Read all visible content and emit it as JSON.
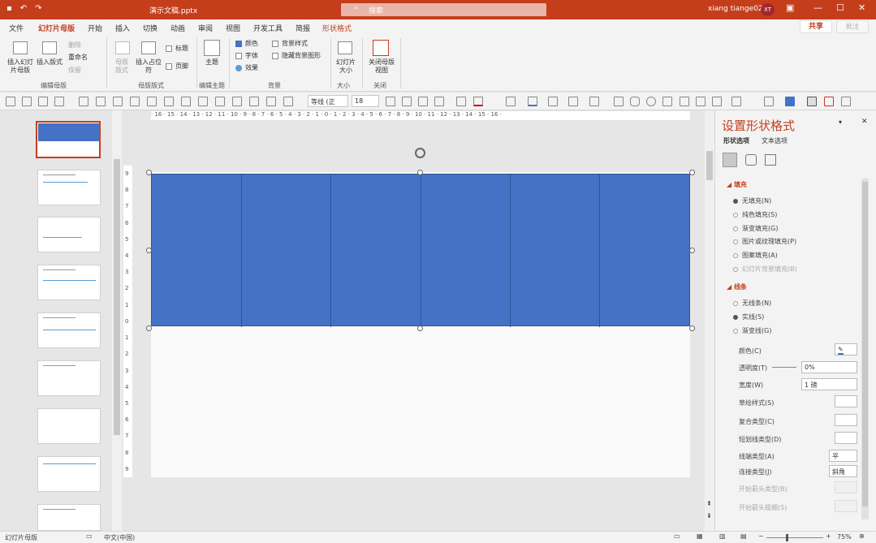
{
  "title_bar": {
    "filename": "演示文稿.pptx",
    "search_placeholder": "搜索",
    "user_name": "xiang tiange02",
    "user_initials": "XT"
  },
  "menu": [
    "文件",
    "幻灯片母版",
    "开始",
    "插入",
    "切换",
    "动画",
    "审阅",
    "视图",
    "开发工具",
    "简报",
    "形状格式"
  ],
  "actions": {
    "share": "共享",
    "comment": "批注"
  },
  "ribbon": {
    "insert_master": "插入幻灯片母版",
    "insert_layout": "插入版式",
    "delete": "删除",
    "rename": "重命名",
    "preserve": "保留",
    "group_edit_master": "编辑母版",
    "master_layout": "母版版式",
    "insert_placeholder": "插入占位符",
    "title_cb": "标题",
    "footer_cb": "页脚",
    "group_master_layout": "母版版式",
    "theme": "主题",
    "group_edit_theme": "编辑主题",
    "colors": "颜色",
    "fonts": "字体",
    "effects": "效果",
    "bg_styles": "背景样式",
    "hide_bg": "隐藏背景图形",
    "group_background": "背景",
    "slide_size": "幻灯片大小",
    "group_size": "大小",
    "close_master": "关闭母版视图",
    "group_close": "关闭"
  },
  "toolbar": {
    "font_name": "等线 (正",
    "font_size": "18"
  },
  "ruler_h": "· 16 · 15 · 14 · 13 · 12 · 11 · 10 · 9 · 8 · 7 · 6 · 5 · 4 · 3 · 2 · 1 · 0 · 1 · 2 · 3 · 4 · 5 · 6 · 7 · 8 · 9 · 10 · 11 · 12 · 13 · 14 · 15 · 16 ·",
  "ruler_v": [
    "9",
    "8",
    "7",
    "6",
    "5",
    "4",
    "3",
    "2",
    "1",
    "0",
    "1",
    "2",
    "3",
    "4",
    "5",
    "6",
    "7",
    "8",
    "9"
  ],
  "pane": {
    "title": "设置形状格式",
    "tab_shape": "形状选项",
    "tab_text": "文本选项",
    "fill_header": "填充",
    "fill_none": "无填充(N)",
    "fill_solid": "纯色填充(S)",
    "fill_gradient": "渐变填充(G)",
    "fill_picture": "图片或纹理填充(P)",
    "fill_pattern": "图案填充(A)",
    "fill_slide_bg": "幻灯片背景填充(B)",
    "line_header": "线条",
    "line_none": "无线条(N)",
    "line_solid": "实线(S)",
    "line_gradient": "渐变线(G)",
    "color": "颜色(C)",
    "transparency": "透明度(T)",
    "transparency_value": "0%",
    "width": "宽度(W)",
    "width_value": "1 磅",
    "sketch_style": "草绘样式(S)",
    "compound_type": "复合类型(C)",
    "dash_type": "短划线类型(D)",
    "cap_type": "线端类型(A)",
    "cap_value": "平",
    "join_type": "连接类型(J)",
    "join_value": "斜角",
    "begin_arrow_type": "开始箭头类型(B)",
    "begin_arrow_size": "开始箭头粗细(S)"
  },
  "status": {
    "view": "幻灯片母版",
    "language": "中文(中国)",
    "zoom": "75%"
  },
  "colors": {
    "accent": "#c43e1c",
    "shape_fill": "#4472c4"
  }
}
